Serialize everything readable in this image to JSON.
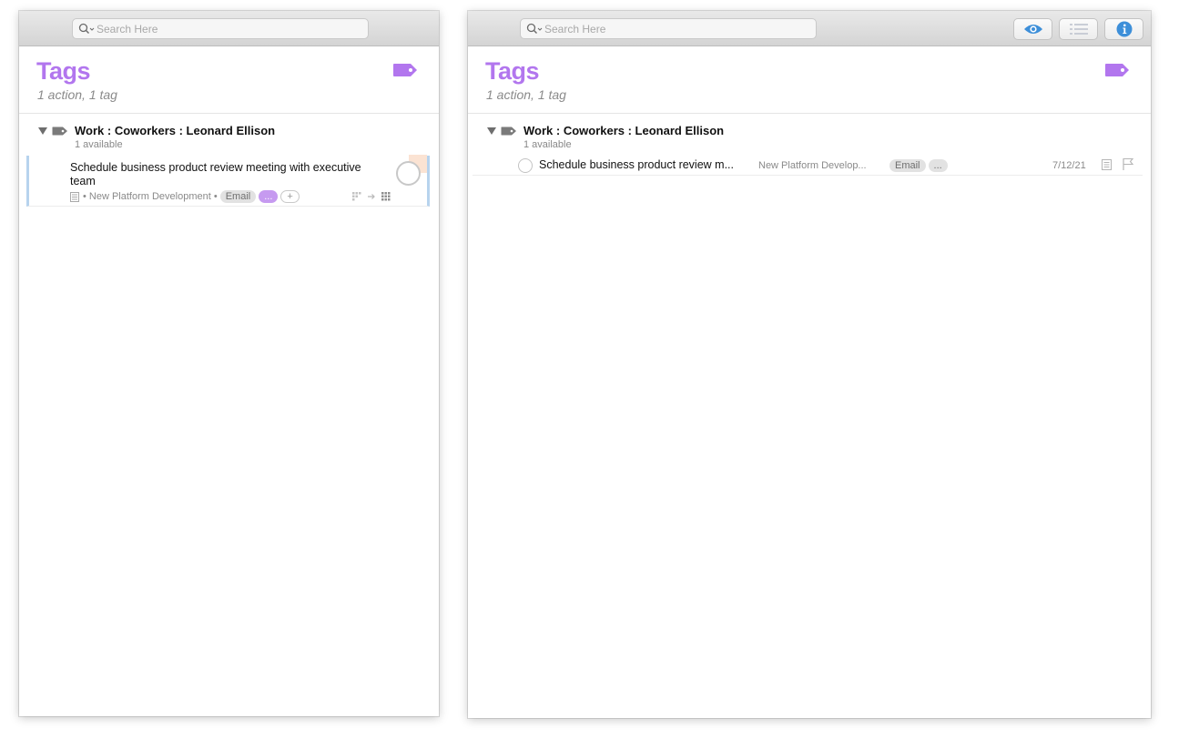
{
  "search": {
    "placeholder": "Search Here"
  },
  "perspective": {
    "title": "Tags",
    "subtitle": "1 action, 1 tag"
  },
  "group": {
    "title": "Work : Coworkers : Leonard Ellison",
    "available": "1 available"
  },
  "task": {
    "title": "Schedule business product review meeting with executive team",
    "title_truncated": "Schedule business product review m...",
    "project_meta": "• New Platform Development •",
    "project_truncated": "New Platform Develop...",
    "tags": [
      "Email",
      "..."
    ],
    "add_tag": "+",
    "date": "7/12/21"
  },
  "toolbar_buttons": [
    "eye-icon",
    "list-icon",
    "info-icon"
  ],
  "colors": {
    "accent_purple": "#b276ee",
    "selection_blue": "#b7d3ee",
    "info_blue": "#3d8fd9"
  }
}
